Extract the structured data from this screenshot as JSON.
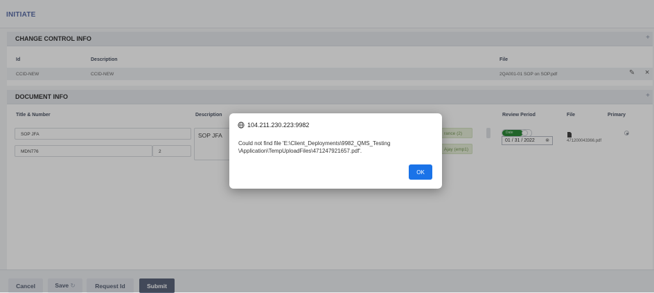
{
  "header": {
    "title": "INITIATE"
  },
  "change_control": {
    "heading": "CHANGE CONTROL INFO",
    "plus": "+",
    "columns": {
      "id": "Id",
      "description": "Description",
      "file": "File"
    },
    "row": {
      "id": "CCID-NEW",
      "description": "CCID-NEW",
      "file": "2QA001-01 SOP on SOP.pdf"
    },
    "edit_glyph": "✎",
    "delete_glyph": "×"
  },
  "document_info": {
    "heading": "DOCUMENT INFO",
    "plus": "+",
    "columns": {
      "title_number": "Title & Number",
      "description": "Description",
      "review_period": "Review Period",
      "file": "File",
      "primary": "Primary"
    },
    "title_value": "SOP JFA",
    "number_value": "MDN776",
    "revision_value": "2",
    "description_value": "SOP JFA",
    "tag1": "rance (2)",
    "tag2": "Ajay (emp1)",
    "toggle_label": "Date",
    "date_value": "01 / 31 / 2022",
    "file_name": "471200043366.pdf"
  },
  "dialog": {
    "origin": "104.211.230.223:9982",
    "message": "Could not find file 'E:\\Client_Deployments\\9982_QMS_Testing \\Application\\TempUploadFiles\\471247921657.pdf'.",
    "ok_label": "OK"
  },
  "footer": {
    "cancel": "Cancel",
    "save": "Save",
    "request_id": "Request Id",
    "submit": "Submit"
  },
  "colors": {
    "accent": "#1a73e8",
    "title": "#5b6ea8",
    "submit": "#5c667c",
    "toggle_on": "#2e8b3a"
  }
}
